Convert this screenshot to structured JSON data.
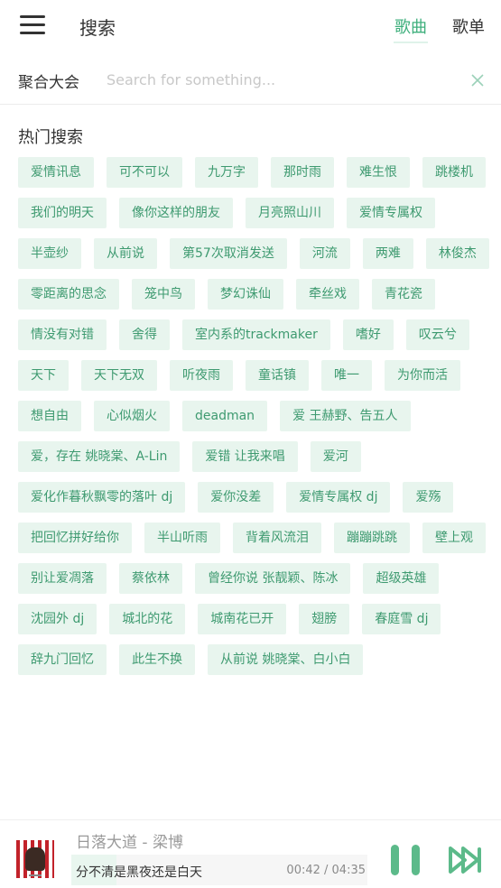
{
  "header": {
    "title": "搜索",
    "tabs": [
      {
        "label": "歌曲",
        "active": true
      },
      {
        "label": "歌单",
        "active": false
      }
    ]
  },
  "search": {
    "source": "聚合大会",
    "value": "",
    "placeholder": "Search for something..."
  },
  "hot": {
    "title": "热门搜索",
    "tags": [
      "爱情讯息",
      "可不可以",
      "九万字",
      "那时雨",
      "难生恨",
      "跳楼机",
      "我们的明天",
      "像你这样的朋友",
      "月亮照山川",
      "爱情专属权",
      "半壶纱",
      "从前说",
      "第57次取消发送",
      "河流",
      "两难",
      "林俊杰",
      "零距离的思念",
      "笼中鸟",
      "梦幻诛仙",
      "牵丝戏",
      "青花瓷",
      "情没有对错",
      "舍得",
      "室内系的trackmaker",
      "嗜好",
      "叹云兮",
      "天下",
      "天下无双",
      "听夜雨",
      "童话镇",
      "唯一",
      "为你而活",
      "想自由",
      "心似烟火",
      "deadman",
      "爱 王赫野、告五人",
      "爱，存在 姚晓棠、A-Lin",
      "爱错 让我来唱",
      "爱河",
      "爱化作暮秋飘零的落叶 dj",
      "爱你没差",
      "爱情专属权 dj",
      "爱殇",
      "把回忆拼好给你",
      "半山听雨",
      "背着风流泪",
      "蹦蹦跳跳",
      "壁上观",
      "别让爱凋落",
      "蔡依林",
      "曾经你说 张靓颖、陈冰",
      "超级英雄",
      "沈园外 dj",
      "城北的花",
      "城南花已开",
      "翅膀",
      "春庭雪 dj",
      "辞九门回忆",
      "此生不换",
      "从前说 姚晓棠、白小白"
    ]
  },
  "player": {
    "song": "日落大道 - 梁博",
    "lyric": "分不清是黑夜还是白天",
    "time": "00:42 / 04:35",
    "progress": 0.153,
    "accent": "#3eaf7c"
  }
}
